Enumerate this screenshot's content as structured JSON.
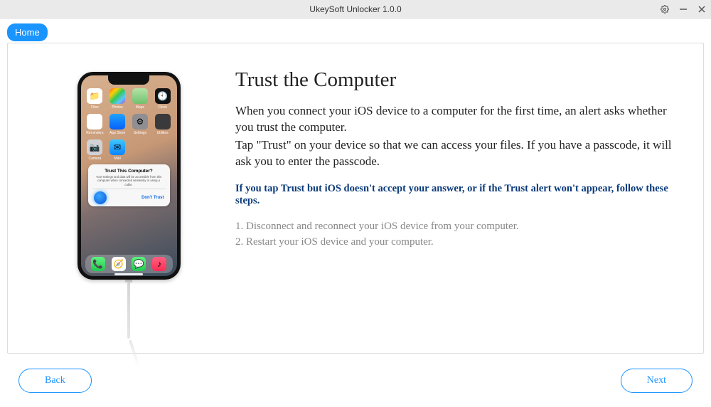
{
  "window": {
    "title": "UkeySoft Unlocker 1.0.0"
  },
  "nav": {
    "home": "Home"
  },
  "content": {
    "heading": "Trust the Computer",
    "para1": "When you connect your iOS device to a computer for the first time, an alert asks whether you trust the computer.",
    "para2": "Tap \"Trust\" on your device so that we can access your files. If you have a passcode, it will ask you to enter the passcode.",
    "blue_note": "If you tap Trust but iOS doesn't accept your answer, or if the Trust alert won't appear, follow these steps.",
    "step1": "1. Disconnect and reconnect your iOS device from your computer.",
    "step2": "2. Restart your iOS device and your computer."
  },
  "phone": {
    "apps_row1": [
      "Files",
      "Photos",
      "Maps",
      "Clock"
    ],
    "apps_row2": [
      "Reminders",
      "App Store",
      "Settings",
      "Utilities"
    ],
    "apps_row3": [
      "Camera",
      "Mail"
    ],
    "dialog": {
      "title": "Trust This Computer?",
      "body": "Your settings and data will be accessible from this computer when connected wirelessly or using a cable.",
      "dont_trust": "Don't Trust"
    }
  },
  "footer": {
    "back": "Back",
    "next": "Next"
  }
}
